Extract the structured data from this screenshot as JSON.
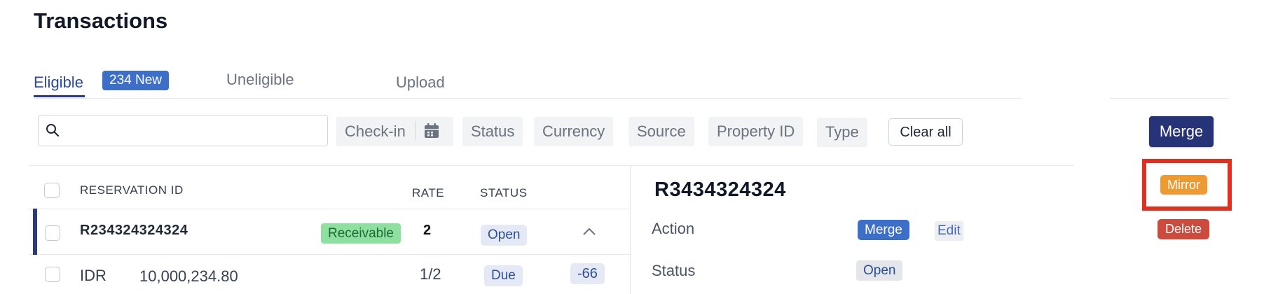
{
  "page": {
    "title": "Transactions"
  },
  "tabs": [
    {
      "label": "Eligible",
      "badge": "234 New",
      "active": true
    },
    {
      "label": "Uneligible"
    },
    {
      "label": "Upload"
    }
  ],
  "search": {
    "placeholder": "",
    "value": ""
  },
  "filters": {
    "checkin": "Check-in",
    "status": "Status",
    "currency": "Currency",
    "source": "Source",
    "property_id": "Property ID",
    "type": "Type",
    "clear_all": "Clear all"
  },
  "toolbar": {
    "merge_label": "Merge"
  },
  "table": {
    "columns": {
      "reservation_id": "RESERVATION ID",
      "rate": "RATE",
      "status": "STATUS"
    },
    "rows": [
      {
        "reservation_id": "R234324324324",
        "tag": "Receivable",
        "rate": "2",
        "status": "Open"
      },
      {
        "currency": "IDR",
        "amount": "10,000,234.80",
        "rate": "1/2",
        "status": "Due",
        "delta": "-66"
      }
    ]
  },
  "detail": {
    "id": "R3434324324",
    "action_label": "Action",
    "action_merge": "Merge",
    "action_edit": "Edit",
    "status_label": "Status",
    "status_value": "Open"
  },
  "side_actions": {
    "mirror": "Mirror",
    "delete": "Delete"
  },
  "colors": {
    "accent": "#263477",
    "badge_blue": "#3d6fc9",
    "receivable_green": "#8fe0a0",
    "mirror_orange": "#ee9a33",
    "delete_red": "#cc4b3f",
    "highlight_red": "#e0301f"
  },
  "icons": {
    "search": "search-icon",
    "calendar": "calendar-icon",
    "chevron": "chevron-up-icon"
  }
}
